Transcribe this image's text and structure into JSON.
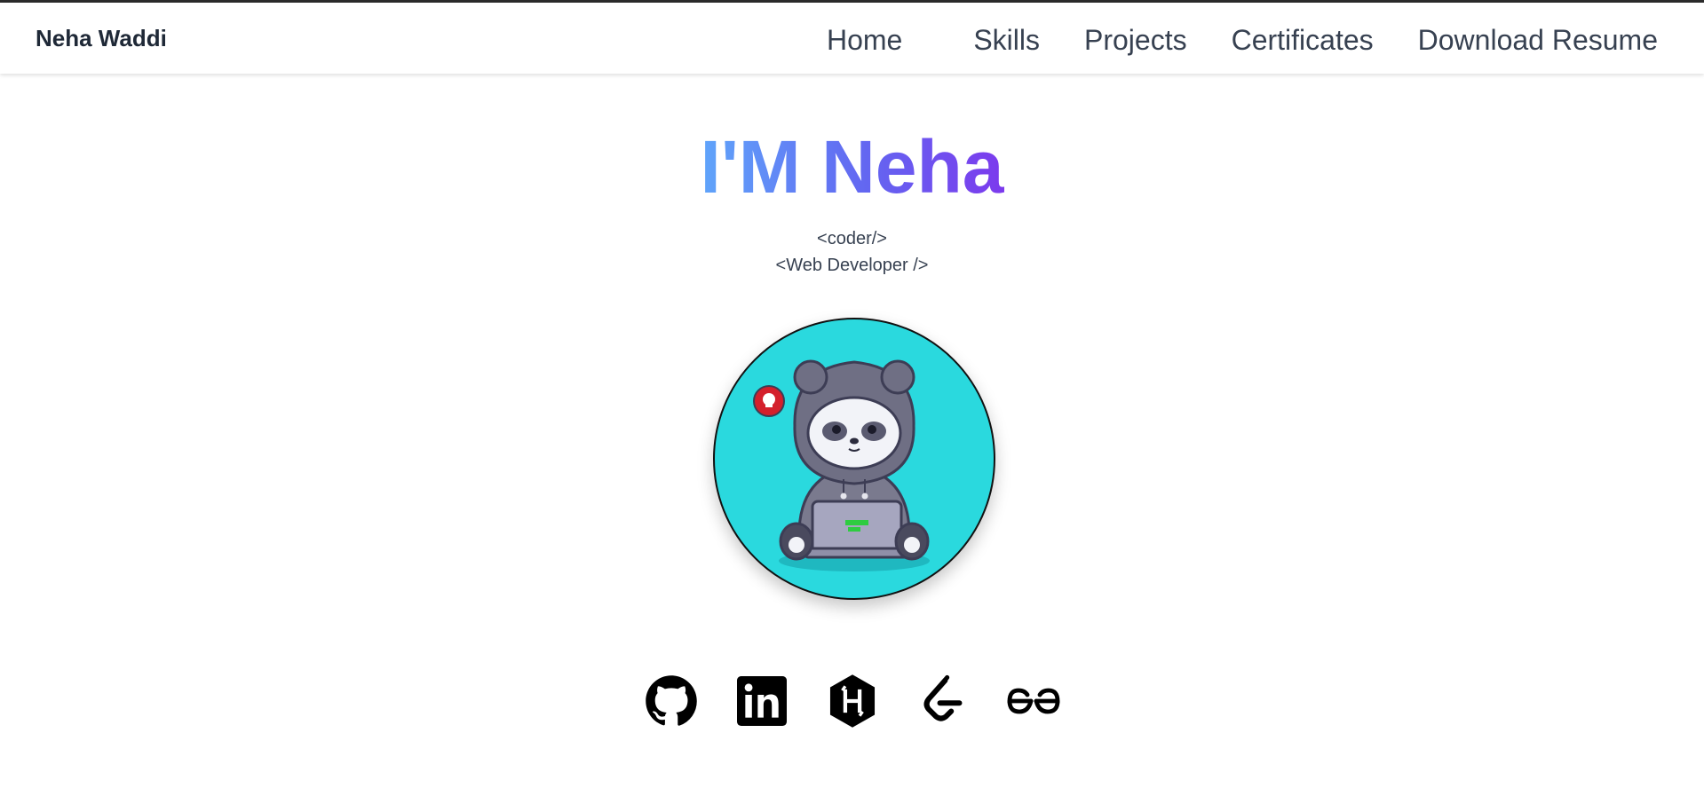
{
  "navbar": {
    "brand": "Neha Waddi",
    "links": [
      {
        "label": "Home"
      },
      {
        "label": "Skills"
      },
      {
        "label": "Projects"
      },
      {
        "label": "Certificates"
      },
      {
        "label": "Download Resume"
      }
    ]
  },
  "hero": {
    "title": "I'M Neha",
    "roles": [
      "<coder/>",
      "<Web Developer />"
    ],
    "avatar": "panda-hacker-avatar",
    "gradient": [
      "#60a5fa",
      "#6366f1",
      "#7c3aed"
    ],
    "avatar_background": "#2ad9de"
  },
  "socials": [
    {
      "icon": "github-icon"
    },
    {
      "icon": "linkedin-icon"
    },
    {
      "icon": "hackerrank-icon"
    },
    {
      "icon": "leetcode-icon"
    },
    {
      "icon": "geeksforgeeks-icon"
    }
  ]
}
